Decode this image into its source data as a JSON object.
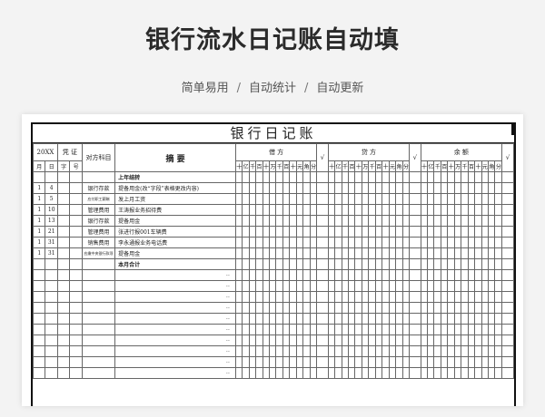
{
  "header": {
    "title": "银行流水日记账自动填",
    "features": [
      "简单易用",
      "自动统计",
      "自动更新"
    ],
    "separator": "/"
  },
  "ledger": {
    "title": "银行日记账",
    "year_label": "20XX",
    "voucher_label": "凭  证",
    "month_label": "月",
    "day_label": "日",
    "zi_label": "字",
    "hao_label": "号",
    "account_label": "对方科目",
    "summary_label": "摘        要",
    "debit_label": "借          方",
    "credit_label": "贷          方",
    "balance_label": "余          额",
    "check_mark": "√",
    "digit_units": [
      "十",
      "亿",
      "千",
      "百",
      "十",
      "万",
      "千",
      "百",
      "十",
      "元",
      "角",
      "分"
    ],
    "rows": [
      {
        "month": "",
        "day": "",
        "account": "",
        "summary": "上年结转",
        "bold": true,
        "mark": ""
      },
      {
        "month": "1",
        "day": "4",
        "account": "银行存款",
        "summary": "提备用金(改“字段”表格更改内容)",
        "bold": false,
        "mark": ""
      },
      {
        "month": "1",
        "day": "5",
        "account": "应付职工薪酬",
        "summary": "发上月工资",
        "bold": false,
        "mark": ""
      },
      {
        "month": "1",
        "day": "10",
        "account": "管理费用",
        "summary": "王涛报业务招待费",
        "bold": false,
        "mark": ""
      },
      {
        "month": "1",
        "day": "13",
        "account": "银行存款",
        "summary": "提备用金",
        "bold": false,
        "mark": ""
      },
      {
        "month": "1",
        "day": "21",
        "account": "管理费用",
        "summary": "张进行报001车辆费",
        "bold": false,
        "mark": ""
      },
      {
        "month": "1",
        "day": "31",
        "account": "销售费用",
        "summary": "李永通报业务电话费",
        "bold": false,
        "mark": ""
      },
      {
        "month": "1",
        "day": "31",
        "account": "应缴中央银行款项",
        "summary": "提备用金",
        "bold": false,
        "mark": ""
      },
      {
        "month": "",
        "day": "",
        "account": "",
        "summary": "本月合计",
        "bold": true,
        "mark": ""
      },
      {
        "month": "",
        "day": "",
        "account": "",
        "summary": "",
        "bold": false,
        "mark": "--"
      },
      {
        "month": "",
        "day": "",
        "account": "",
        "summary": "",
        "bold": false,
        "mark": "--"
      },
      {
        "month": "",
        "day": "",
        "account": "",
        "summary": "",
        "bold": false,
        "mark": "--"
      },
      {
        "month": "",
        "day": "",
        "account": "",
        "summary": "",
        "bold": false,
        "mark": "--"
      },
      {
        "month": "",
        "day": "",
        "account": "",
        "summary": "",
        "bold": false,
        "mark": "--"
      },
      {
        "month": "",
        "day": "",
        "account": "",
        "summary": "",
        "bold": false,
        "mark": "--"
      },
      {
        "month": "",
        "day": "",
        "account": "",
        "summary": "",
        "bold": false,
        "mark": "--"
      },
      {
        "month": "",
        "day": "",
        "account": "",
        "summary": "",
        "bold": false,
        "mark": "--"
      },
      {
        "month": "",
        "day": "",
        "account": "",
        "summary": "",
        "bold": false,
        "mark": "--"
      },
      {
        "month": "",
        "day": "",
        "account": "",
        "summary": "",
        "bold": false,
        "mark": "--"
      }
    ]
  }
}
